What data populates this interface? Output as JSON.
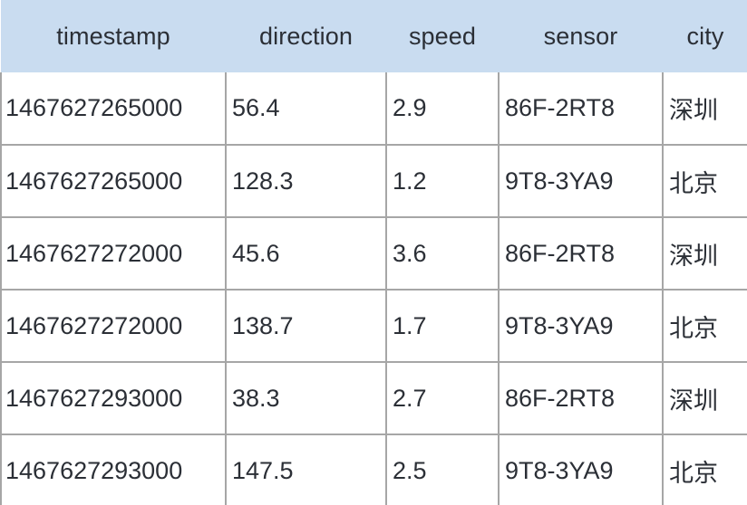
{
  "table": {
    "columns": [
      {
        "key": "timestamp",
        "label": "timestamp"
      },
      {
        "key": "direction",
        "label": "direction"
      },
      {
        "key": "speed",
        "label": "speed"
      },
      {
        "key": "sensor",
        "label": "sensor"
      },
      {
        "key": "city",
        "label": "city"
      }
    ],
    "rows": [
      {
        "timestamp": "1467627265000",
        "direction": "56.4",
        "speed": "2.9",
        "sensor": "86F-2RT8",
        "city": "深圳"
      },
      {
        "timestamp": "1467627265000",
        "direction": "128.3",
        "speed": "1.2",
        "sensor": "9T8-3YA9",
        "city": "北京"
      },
      {
        "timestamp": "1467627272000",
        "direction": "45.6",
        "speed": "3.6",
        "sensor": "86F-2RT8",
        "city": "深圳"
      },
      {
        "timestamp": "1467627272000",
        "direction": "138.7",
        "speed": "1.7",
        "sensor": "9T8-3YA9",
        "city": "北京"
      },
      {
        "timestamp": "1467627293000",
        "direction": "38.3",
        "speed": "2.7",
        "sensor": "86F-2RT8",
        "city": "深圳"
      },
      {
        "timestamp": "1467627293000",
        "direction": "147.5",
        "speed": "2.5",
        "sensor": "9T8-3YA9",
        "city": "北京"
      }
    ]
  },
  "colors": {
    "header_background": "#c9dcf0",
    "cell_background": "#ffffff",
    "grid_line": "#a6a6a6",
    "text": "#2b2f36"
  }
}
